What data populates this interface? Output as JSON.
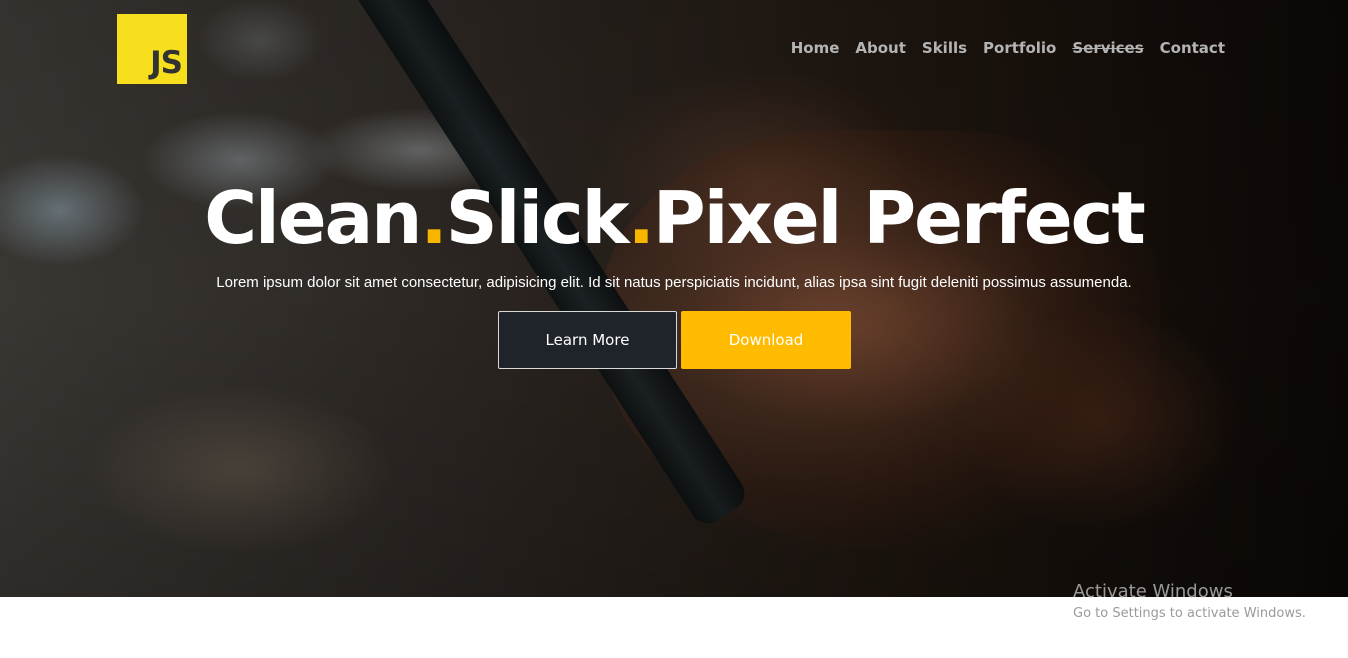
{
  "logo": {
    "text": "JS"
  },
  "nav": {
    "items": [
      {
        "label": "Home"
      },
      {
        "label": "About"
      },
      {
        "label": "Skills"
      },
      {
        "label": "Portfolio"
      },
      {
        "label": "Services"
      },
      {
        "label": "Contact"
      }
    ]
  },
  "hero": {
    "headline": {
      "word1": "Clean",
      "sep1": ".",
      "word2": "Slick",
      "sep2": ".",
      "word3": "Pixel Perfect"
    },
    "subtitle": "Lorem ipsum dolor sit amet consectetur, adipisicing elit. Id sit natus perspiciatis incidunt, alias ipsa sint fugit deleniti possimus assumenda.",
    "buttons": {
      "learn_more": "Learn More",
      "download": "Download"
    }
  },
  "windows_watermark": {
    "title": "Activate Windows",
    "subtitle": "Go to Settings to activate Windows."
  },
  "colors": {
    "accent": "#ffbb00",
    "logo_bg": "#f7df1e",
    "learn_more_bg": "#1f232a"
  }
}
